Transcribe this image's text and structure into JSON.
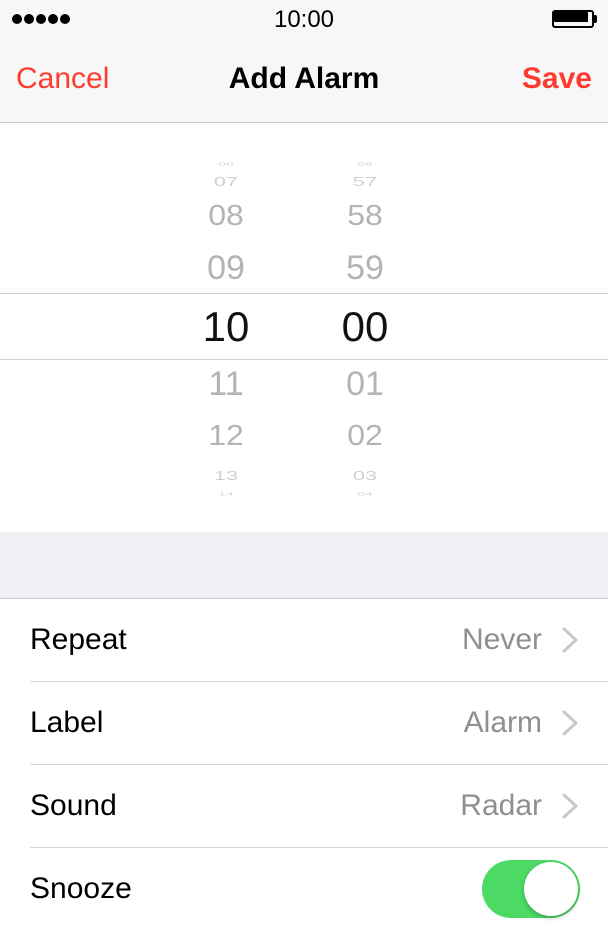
{
  "status_bar": {
    "time": "10:00",
    "signal_icon": "signal-dots-icon",
    "battery_icon": "battery-full-icon"
  },
  "nav": {
    "cancel_label": "Cancel",
    "title": "Add Alarm",
    "save_label": "Save"
  },
  "time_picker": {
    "hours": [
      "06",
      "07",
      "08",
      "09",
      "10",
      "11",
      "12",
      "13",
      "14"
    ],
    "minutes": [
      "56",
      "57",
      "58",
      "59",
      "00",
      "01",
      "02",
      "03",
      "04"
    ],
    "selected_hour": "10",
    "selected_minute": "00"
  },
  "settings": [
    {
      "label": "Repeat",
      "value": "Never"
    },
    {
      "label": "Label",
      "value": "Alarm"
    },
    {
      "label": "Sound",
      "value": "Radar"
    }
  ],
  "snooze": {
    "label": "Snooze",
    "enabled": true
  },
  "colors": {
    "accent": "#ff3b30",
    "toggle_on": "#4cd964",
    "secondary_text": "#8e8e93",
    "group_background": "#efeff4"
  }
}
